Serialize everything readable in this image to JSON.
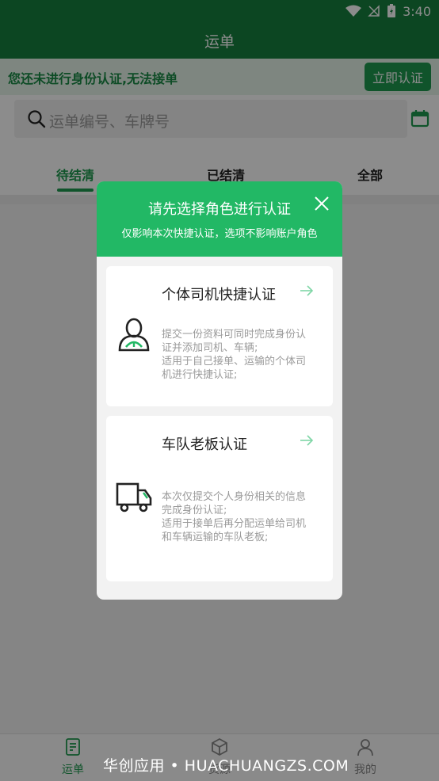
{
  "status_bar": {
    "time": "3:40",
    "icons": [
      "wifi-icon",
      "signal-icon",
      "battery-icon"
    ]
  },
  "header": {
    "title": "运单"
  },
  "banner": {
    "text": "您还未进行身份认证,无法接单",
    "button_label": "立即认证"
  },
  "search": {
    "placeholder": "运单编号、车牌号"
  },
  "tabs": [
    {
      "label": "待结清",
      "active": true
    },
    {
      "label": "已结清",
      "active": false
    },
    {
      "label": "全部",
      "active": false
    }
  ],
  "bottom_nav": [
    {
      "label": "运单",
      "icon": "document-icon",
      "active": true
    },
    {
      "label": "货源",
      "icon": "box-icon",
      "active": false
    },
    {
      "label": "我的",
      "icon": "user-icon",
      "active": false
    }
  ],
  "watermark": "华创应用 • HUACHUANGZS.COM",
  "modal": {
    "title": "请先选择角色进行认证",
    "subtitle": "仅影响本次快捷认证，选项不影响账户角色",
    "cards": [
      {
        "title": "个体司机快捷认证",
        "icon": "driver-icon",
        "description": [
          "提交一份资料可同时完成身份认",
          "证并添加司机、车辆;",
          "适用于自己接单、运输的个体司",
          "机进行快捷认证;"
        ]
      },
      {
        "title": "车队老板认证",
        "icon": "truck-icon",
        "description": [
          "本次仅提交个人身份相关的信息",
          "完成身份认证;",
          "适用于接单后再分配运单给司机",
          "和车辆运输的车队老板;"
        ]
      }
    ]
  },
  "colors": {
    "primary": "#17803f",
    "accent": "#22b865",
    "banner_bg": "#e6f4ea"
  }
}
